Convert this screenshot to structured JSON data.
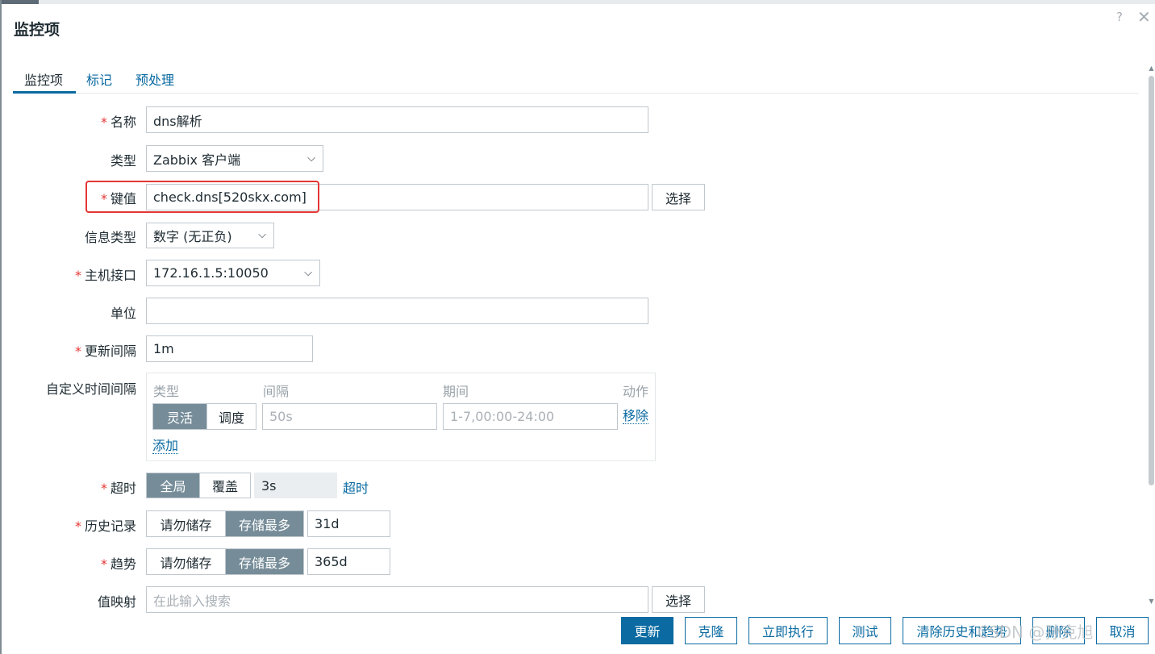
{
  "dialog": {
    "title": "监控项"
  },
  "tabs": [
    "监控项",
    "标记",
    "预处理"
  ],
  "form": {
    "name": {
      "label": "名称",
      "value": "dns解析"
    },
    "type": {
      "label": "类型",
      "value": "Zabbix 客户端"
    },
    "key": {
      "label": "键值",
      "value": "check.dns[520skx.com]",
      "select_label": "选择"
    },
    "info_type": {
      "label": "信息类型",
      "value": "数字 (无正负)"
    },
    "host_interface": {
      "label": "主机接口",
      "value": "172.16.1.5:10050"
    },
    "units": {
      "label": "单位",
      "value": ""
    },
    "update_interval": {
      "label": "更新间隔",
      "value": "1m"
    },
    "custom_intervals": {
      "label": "自定义时间间隔",
      "columns": [
        "类型",
        "间隔",
        "期间",
        "动作"
      ],
      "mode_options": [
        "灵活",
        "调度"
      ],
      "mode_selected": "灵活",
      "interval_placeholder": "50s",
      "period_placeholder": "1-7,00:00-24:00",
      "remove_label": "移除",
      "add_label": "添加"
    },
    "timeout": {
      "label": "超时",
      "options": [
        "全局",
        "覆盖"
      ],
      "selected": "全局",
      "value": "3s",
      "link": "超时"
    },
    "history": {
      "label": "历史记录",
      "options": [
        "请勿储存",
        "存储最多"
      ],
      "selected": "存储最多",
      "value": "31d"
    },
    "trends": {
      "label": "趋势",
      "options": [
        "请勿储存",
        "存储最多"
      ],
      "selected": "存储最多",
      "value": "365d"
    },
    "value_map": {
      "label": "值映射",
      "placeholder": "在此输入搜索",
      "select_label": "选择"
    }
  },
  "footer": {
    "update": "更新",
    "clone": "克隆",
    "execute_now": "立即执行",
    "test": "测试",
    "clear_history": "清除历史和趋势",
    "delete": "删除",
    "cancel": "取消"
  },
  "watermark": "CSDN @孙克旭",
  "colors": {
    "accent": "#0a6aa1",
    "required": "#e33734",
    "segment_selected": "#768d99",
    "highlight": "#e33734"
  }
}
